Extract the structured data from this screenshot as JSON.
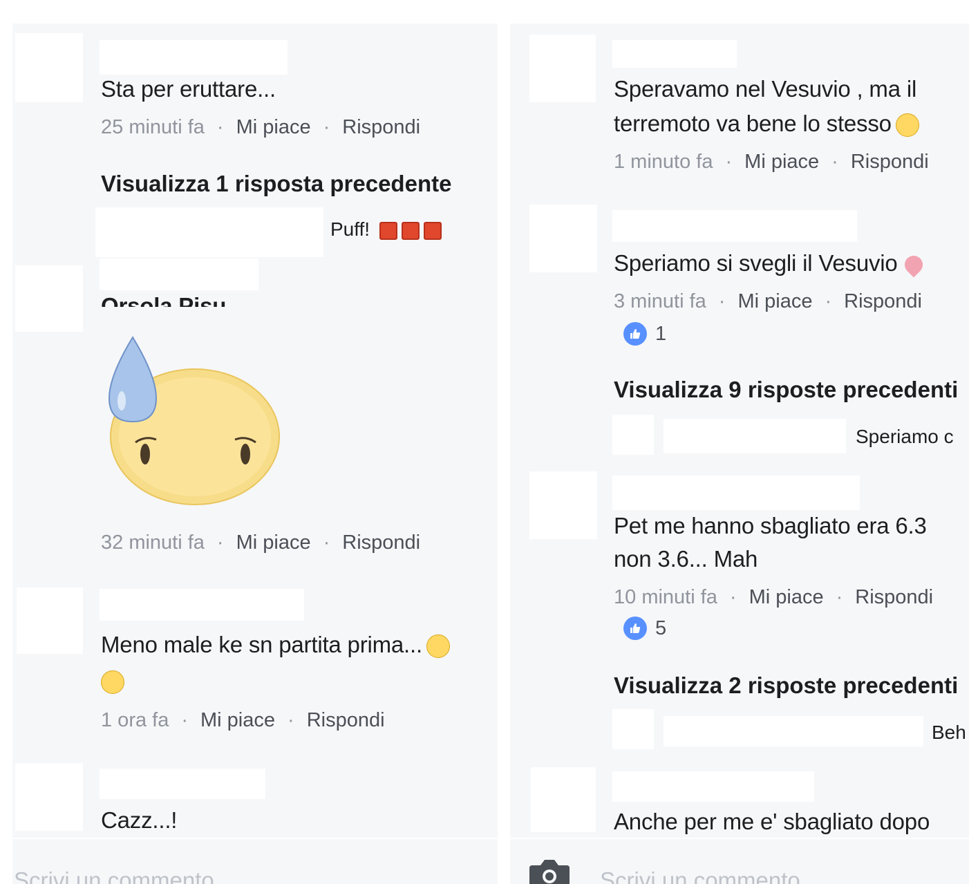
{
  "left": {
    "comments": [
      {
        "text": "Sta per eruttare...",
        "time": "25 minuti fa",
        "like": "Mi piace",
        "reply": "Rispondi"
      },
      {
        "view_prev": "Visualizza 1 risposta precedente",
        "reply_snippet": "Puff!"
      },
      {
        "partial_name": "Orsola Pisu",
        "time": "32 minuti fa",
        "like": "Mi piace",
        "reply": "Rispondi"
      },
      {
        "text": "Meno male ke sn partita prima...",
        "time": "1 ora fa",
        "like": "Mi piace",
        "reply": "Rispondi"
      },
      {
        "text": "Cazz...!"
      }
    ],
    "composer_placeholder": "Scrivi un commento..."
  },
  "right": {
    "comments": [
      {
        "line1": "Speravamo nel Vesuvio , ma il",
        "line2": "terremoto va bene lo stesso",
        "time": "1 minuto fa",
        "like": "Mi piace",
        "reply": "Rispondi"
      },
      {
        "text": "Speriamo si svegli il Vesuvio",
        "time": "3 minuti fa",
        "like": "Mi piace",
        "reply": "Rispondi",
        "likes": "1",
        "view_prev": "Visualizza 9 risposte precedenti",
        "reply_snippet": "Speriamo c"
      },
      {
        "line1": "Pet me hanno sbagliato era 6.3",
        "line2": "non 3.6... Mah",
        "time": "10 minuti fa",
        "like": "Mi piace",
        "reply": "Rispondi",
        "likes": "5",
        "view_prev": "Visualizza 2 risposte precedenti",
        "reply_snippet": "Beh"
      },
      {
        "text": "Anche per me e' sbagliato dopo"
      }
    ],
    "composer_placeholder": "Scrivi un commento..."
  },
  "colors": {
    "panel_bg": "#f6f7f9",
    "meta": "#90949c",
    "like_blue": "#5890ff"
  }
}
